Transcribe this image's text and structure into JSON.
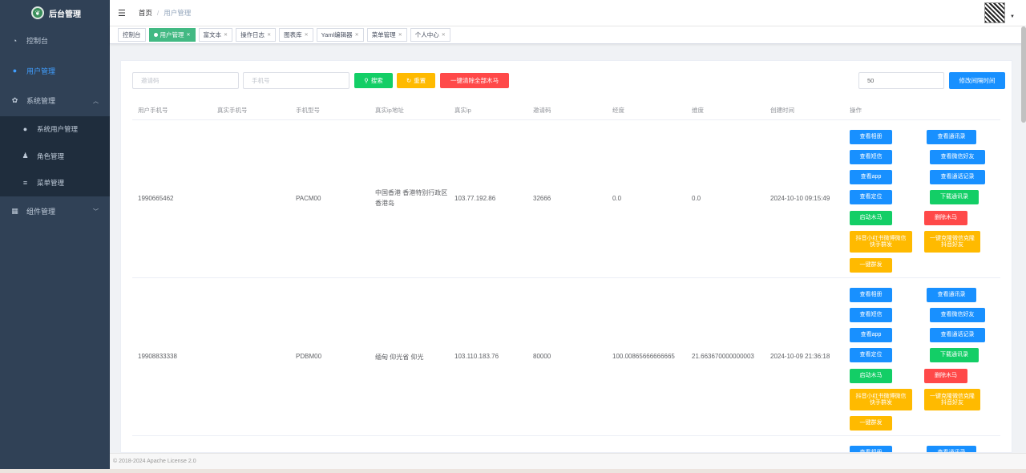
{
  "app": {
    "title": "后台管理"
  },
  "sidebar": {
    "items": [
      {
        "label": "控制台",
        "icon": "dashboard-icon"
      },
      {
        "label": "用户管理",
        "icon": "user-icon",
        "active": true
      },
      {
        "label": "系统管理",
        "icon": "gear-icon",
        "expanded": true
      },
      {
        "label": "组件管理",
        "icon": "grid-icon"
      }
    ],
    "sub_items": [
      {
        "label": "系统用户管理",
        "icon": "users-icon"
      },
      {
        "label": "角色管理",
        "icon": "role-icon"
      },
      {
        "label": "菜单管理",
        "icon": "menu-list-icon"
      }
    ]
  },
  "breadcrumb": {
    "home": "首页",
    "current": "用户管理"
  },
  "tags": [
    "控制台",
    "用户管理",
    "富文本",
    "操作日志",
    "图表库",
    "Yaml编辑器",
    "菜单管理",
    "个人中心"
  ],
  "search": {
    "invite_placeholder": "邀请码",
    "phone_placeholder": "手机号",
    "search_label": "搜索",
    "reset_label": "重置",
    "clear_label": "一键清除全部木马",
    "interval_value": "50",
    "interval_button": "修改间隔时间"
  },
  "table": {
    "headers": [
      "用户手机号",
      "真实手机号",
      "手机型号",
      "真实ip地址",
      "真实ip",
      "邀请码",
      "经度",
      "维度",
      "创建时间",
      "操作"
    ],
    "rows": [
      {
        "user_phone": "1990665462",
        "real_phone": "",
        "model": "PACM00",
        "ip_addr": "中国香港 香港特别行政区 香港岛",
        "ip": "103.77.192.86",
        "invite": "32666",
        "lng": "0.0",
        "lat": "0.0",
        "created": "2024-10-10 09:15:49"
      },
      {
        "user_phone": "19908833338",
        "real_phone": "",
        "model": "PDBM00",
        "ip_addr": "缅甸 仰光省 仰光",
        "ip": "103.110.183.76",
        "invite": "80000",
        "lng": "100.00865666666665",
        "lat": "21.663670000000003",
        "created": "2024-10-09 21:36:18"
      }
    ],
    "actions": {
      "album": "查看相册",
      "contacts": "查看通讯录",
      "sms": "查看短信",
      "wechat": "查看微信好友",
      "apps": "查看app",
      "calls": "查看通话记录",
      "location": "查看定位",
      "download": "下载通讯录",
      "start_trojan": "启动木马",
      "delete_trojan": "删除木马",
      "mass_send_1": "抖音小红书微博微信快手群发",
      "mass_send_2": "一键克隆微信克隆抖音好友",
      "mass_send": "一键群发"
    }
  },
  "footer": {
    "text": "© 2018-2024 Apache License 2.0"
  },
  "colors": {
    "sidebar": "#304156",
    "active": "#409eff",
    "tag_active": "#42b983",
    "green": "#13ce66",
    "orange": "#ffba00",
    "red": "#ff4949",
    "blue": "#1890ff"
  }
}
